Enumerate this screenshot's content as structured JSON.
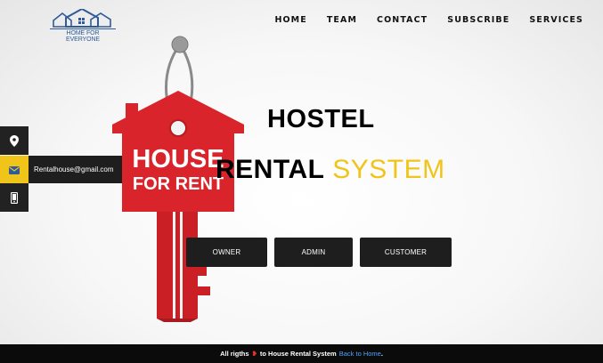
{
  "header": {
    "logo_text": "HOME FOR EVERYONE",
    "nav": [
      "HOME",
      "TEAM",
      "CONTACT",
      "SUBSCRIBE",
      "SERVICES"
    ]
  },
  "hero": {
    "line1": "HOSTEL",
    "line2_word1": "RENTAL",
    "line2_word2": "SYSTEM",
    "key_sign_line1": "HOUSE",
    "key_sign_line2": "FOR RENT",
    "buttons": [
      "OWNER",
      "ADMIN",
      "CUSTOMER"
    ]
  },
  "sidebar": {
    "email": "Rentalhouse@gmail.com",
    "icons": [
      "location-pin-icon",
      "envelope-icon",
      "mobile-phone-icon"
    ]
  },
  "footer": {
    "text_before": "All rigths",
    "heart": "❥",
    "text_after": "to House Rental System",
    "link": "Back to Home",
    "end": "."
  },
  "colors": {
    "accent_yellow": "#f0c419",
    "key_red": "#d8242a",
    "dark": "#1e1e1e",
    "link_blue": "#4ea3ff"
  }
}
